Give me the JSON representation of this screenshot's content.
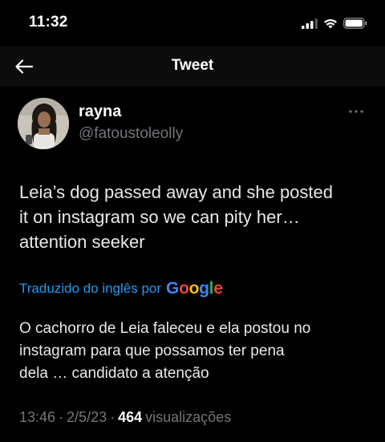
{
  "status_bar": {
    "time": "11:32"
  },
  "nav": {
    "title": "Tweet"
  },
  "tweet": {
    "author_name": "rayna",
    "author_handle": "@fatoustoleolly",
    "text": "Leia’s dog passed away and she posted\nit on instagram so we can pity her…\nattention seeker",
    "translation_label": "Traduzido do inglês por",
    "translation_provider": {
      "g1": "G",
      "o1": "o",
      "o2": "o",
      "g2": "g",
      "l": "l",
      "e": "e"
    },
    "translated_text": "O cachorro de Leia faleceu e ela postou no\ninstagram para que possamos ter pena\ndela … candidato a atenção",
    "time": "13:46",
    "separator": "·",
    "date": "2/5/23",
    "views_count": "464",
    "views_label": "visualizações"
  },
  "colors": {
    "background": "#000000",
    "accent_link": "#1d9bf0",
    "secondary_text": "#71767b"
  }
}
